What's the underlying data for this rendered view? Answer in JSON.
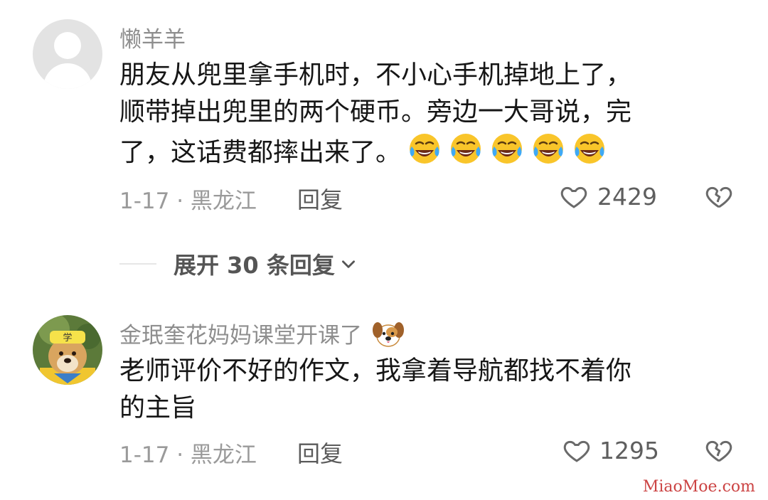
{
  "comments": [
    {
      "username": "懒羊羊",
      "text_line1": "朋友从兜里拿手机时，不小心手机掉地上了，",
      "text_line2": "顺带掉出兜里的两个硬币。旁边一大哥说，完",
      "text_line3": "了，这话费都摔出来了。",
      "emoji_count": 5,
      "date_location": "1-17 · 黑龙江",
      "reply_label": "回复",
      "likes": "2429",
      "avatar": "default-avatar-icon"
    },
    {
      "username": "金珉奎花妈妈课堂开课了",
      "text_line1": "老师评价不好的作文，我拿着导航都找不着你",
      "text_line2": "的主旨",
      "date_location": "1-17 · 黑龙江",
      "reply_label": "回复",
      "likes": "1295",
      "avatar": "dog-avatar-icon"
    }
  ],
  "expand_replies": "展开 30 条回复",
  "watermark": "MiaoMoe.com"
}
